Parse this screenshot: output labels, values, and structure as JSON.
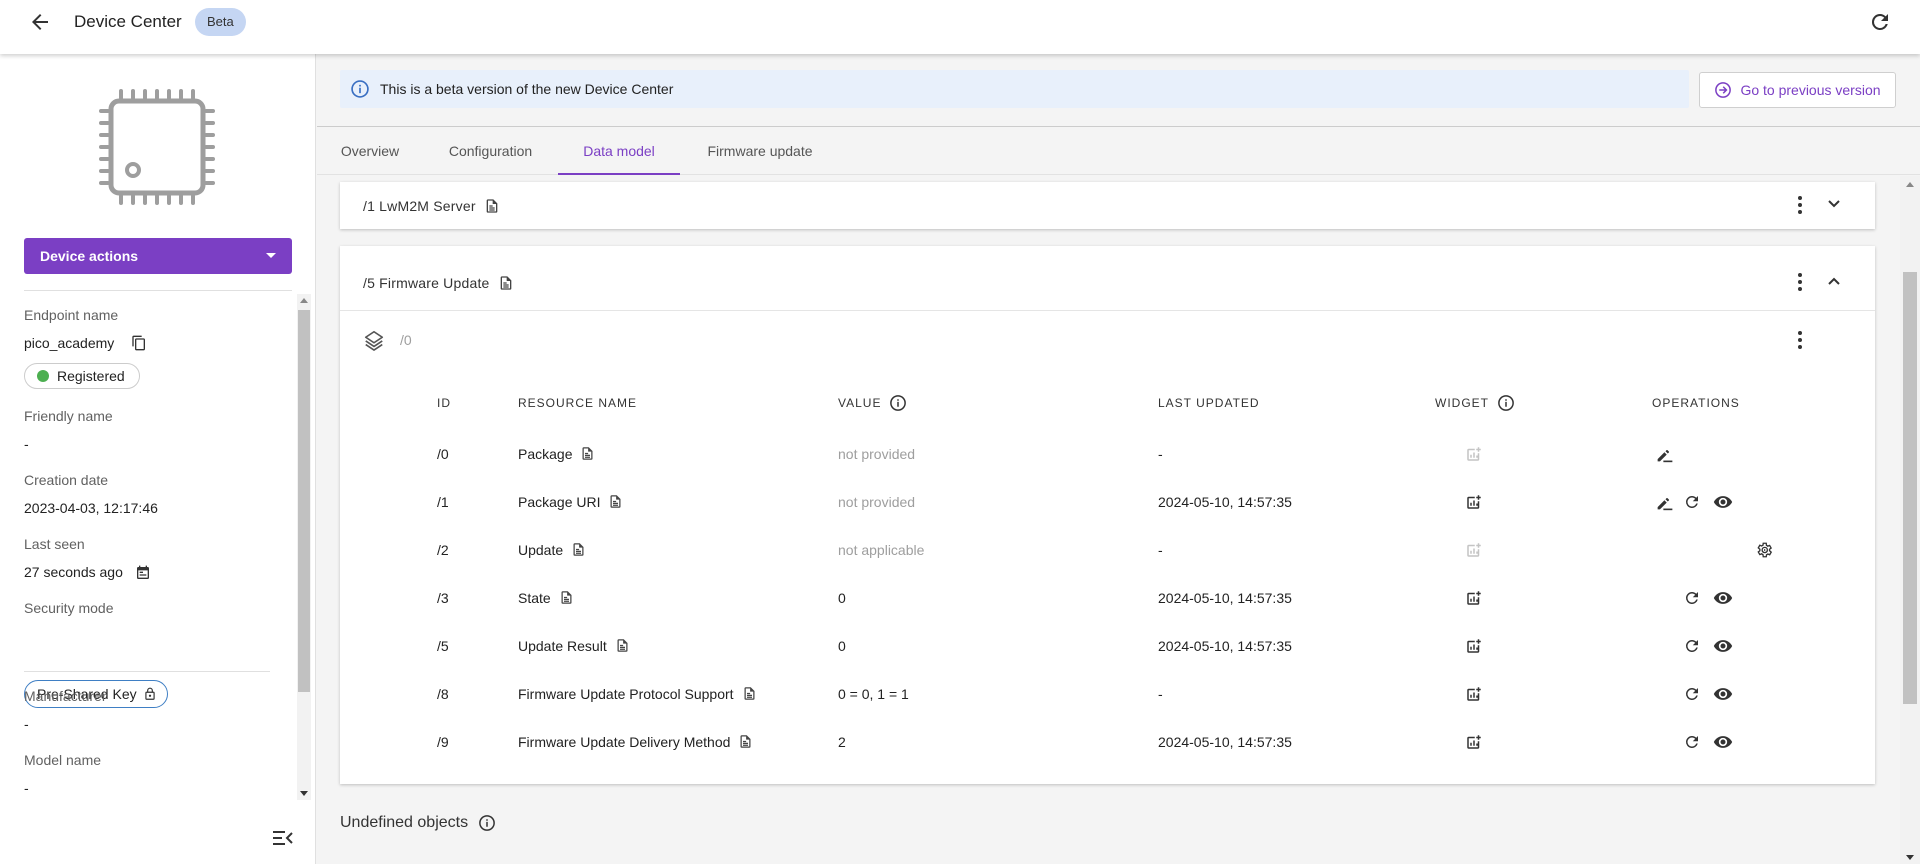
{
  "app": {
    "title": "Device Center",
    "badge": "Beta"
  },
  "sidebar": {
    "device_actions_label": "Device actions",
    "endpoint_label": "Endpoint name",
    "endpoint_value": "pico_academy",
    "status": "Registered",
    "status_color": "#4caf50",
    "friendly_label": "Friendly name",
    "friendly_value": "-",
    "creation_label": "Creation date",
    "creation_value": "2023-04-03, 12:17:46",
    "last_seen_label": "Last seen",
    "last_seen_value": "27 seconds ago",
    "security_label": "Security mode",
    "security_value": "Pre-Shared Key",
    "manufacturer_label": "Manufacturer",
    "manufacturer_value": "-",
    "model_label": "Model name",
    "model_value": "-"
  },
  "banner": {
    "text": "This is a beta version of the new Device Center",
    "button": "Go to previous version"
  },
  "tabs": [
    {
      "label": "Overview",
      "active": false
    },
    {
      "label": "Configuration",
      "active": false
    },
    {
      "label": "Data model",
      "active": true
    },
    {
      "label": "Firmware update",
      "active": false
    }
  ],
  "objects": {
    "server": {
      "title": "/1 LwM2M Server"
    },
    "firmware": {
      "title": "/5 Firmware Update",
      "instance": "/0"
    }
  },
  "table": {
    "headers": {
      "id": "ID",
      "name": "RESOURCE NAME",
      "value": "VALUE",
      "last_updated": "LAST UPDATED",
      "widget": "WIDGET",
      "operations": "OPERATIONS"
    },
    "rows": [
      {
        "id": "/0",
        "name": "Package",
        "value": "not provided",
        "updated": "-",
        "widget_enabled": false,
        "ops": [
          "write"
        ]
      },
      {
        "id": "/1",
        "name": "Package URI",
        "value": "not provided",
        "updated": "2024-05-10, 14:57:35",
        "widget_enabled": true,
        "ops": [
          "write",
          "read",
          "observe"
        ]
      },
      {
        "id": "/2",
        "name": "Update",
        "value": "not applicable",
        "updated": "-",
        "widget_enabled": false,
        "ops": [
          "execute"
        ]
      },
      {
        "id": "/3",
        "name": "State",
        "value": "0",
        "updated": "2024-05-10, 14:57:35",
        "widget_enabled": true,
        "ops": [
          "read",
          "observe"
        ]
      },
      {
        "id": "/5",
        "name": "Update Result",
        "value": "0",
        "updated": "2024-05-10, 14:57:35",
        "widget_enabled": true,
        "ops": [
          "read",
          "observe"
        ]
      },
      {
        "id": "/8",
        "name": "Firmware Update Protocol Support",
        "value": "0 = 0, 1 = 1",
        "updated": "-",
        "widget_enabled": true,
        "ops": [
          "read",
          "observe"
        ]
      },
      {
        "id": "/9",
        "name": "Firmware Update Delivery Method",
        "value": "2",
        "updated": "2024-05-10, 14:57:35",
        "widget_enabled": true,
        "ops": [
          "read",
          "observe"
        ]
      }
    ]
  },
  "undefined_objects": "Undefined objects",
  "colors": {
    "accent": "#7b3fc4",
    "banner_bg": "#e8f0fb",
    "badge_bg": "#c5d6f3"
  }
}
